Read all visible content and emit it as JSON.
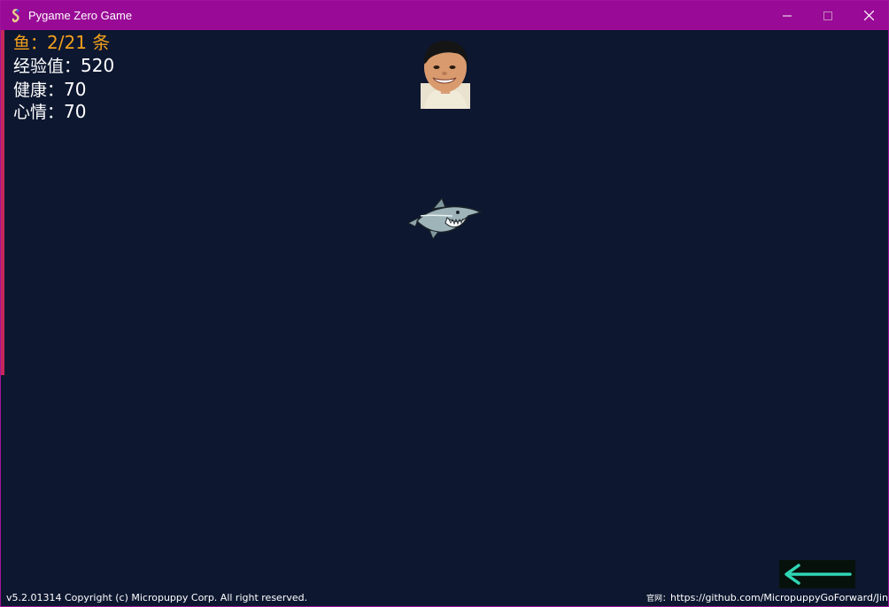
{
  "window": {
    "title": "Pygame Zero Game",
    "icon": "pygame-snake-icon",
    "controls": [
      "minimize-icon",
      "maximize-icon",
      "close-icon"
    ]
  },
  "stats": {
    "fish": {
      "label": "鱼：",
      "value": "2/21 条"
    },
    "exp": {
      "label": "经验值：",
      "value": "520"
    },
    "health": {
      "label": "健康：",
      "value": "70"
    },
    "mood": {
      "label": "心情：",
      "value": "70"
    }
  },
  "sprites": {
    "player_avatar": "avatar-face",
    "enemy": "shark-sprite",
    "back_button": "back-arrow-icon"
  },
  "footer": {
    "version": "v5.2.01314 Copyright (c) Micropuppy Corp. All right reserved.",
    "site_label": "官网：",
    "site_url": "https://github.com/MicropuppyGoForward/Jin"
  },
  "colors": {
    "titlebar": "#990a96",
    "background": "#0d1730",
    "fish_text": "#f2a01c",
    "stat_text": "#ffffff",
    "accent_bar": "#c4285a",
    "arrow": "#2fd6b4"
  }
}
